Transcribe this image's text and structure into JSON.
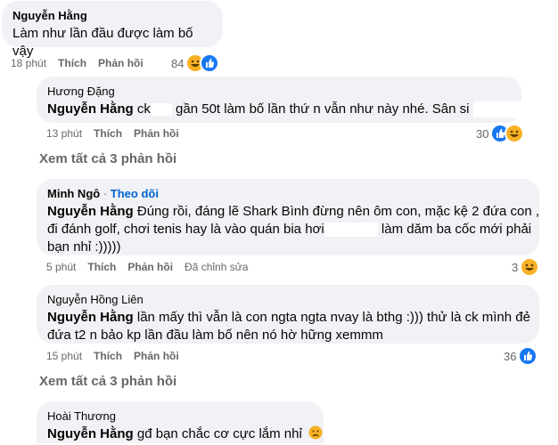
{
  "comments": [
    {
      "author": "Nguyễn Hằng",
      "text": "Làm như lần đầu được làm bố vậy",
      "time": "18 phút",
      "like": "Thích",
      "reply": "Phản hồi",
      "reactions": "84",
      "reaction_icons": [
        "haha-icon",
        "like-icon"
      ]
    },
    {
      "author": "Hương Đặng",
      "tag": "Nguyễn Hằng",
      "text_a": "ck",
      "text_b": "gần 50t làm bố lần thứ n vẫn như này nhé. Sân si",
      "time": "13 phút",
      "like": "Thích",
      "reply": "Phản hồi",
      "reactions": "30",
      "reaction_icons": [
        "like-icon",
        "haha-icon"
      ]
    },
    {
      "author": "Minh Ngô",
      "follow": "Theo dõi",
      "tag": "Nguyễn Hằng",
      "line1": "Đúng rồi, đáng lẽ Shark Bình đừng nên ôm con, mặc kệ 2 đứa con ,",
      "line2": "đi đánh golf, chơi tenis hay là vào quán bia hơi",
      "line2b": "làm dăm ba cốc mới phải",
      "line3": "bạn nhỉ :)))))",
      "time": "5 phút",
      "like": "Thích",
      "reply": "Phản hồi",
      "edited": "Đã chỉnh sửa",
      "reactions": "3",
      "reaction_icons": [
        "haha-icon"
      ]
    },
    {
      "author": "Nguyễn Hồng Liên",
      "tag": "Nguyễn Hằng",
      "line1": "lần mấy thì vẫn là con ngta ngta nvay là bthg :))) thử là ck mình đẻ",
      "line2": "đứa t2 n bảo kp lần đầu làm bố nên nó hờ hững xemmm",
      "time": "15 phút",
      "like": "Thích",
      "reply": "Phản hồi",
      "reactions": "36",
      "reaction_icons": [
        "like-icon"
      ]
    },
    {
      "author": "Hoài Thương",
      "tag": "Nguyễn Hằng",
      "text": "gđ bạn chắc cơ cực lắm nhỉ",
      "emoji": "sad-face-icon"
    }
  ],
  "see_all_1": "Xem tất cả 3 phản hồi",
  "see_all_2": "Xem tất cả 3 phản hồi",
  "colors": {
    "bubble": "#f0f2f5",
    "meta": "#65676b",
    "link": "#0064d1",
    "like": "#1877f2",
    "haha": "#f7b125"
  }
}
